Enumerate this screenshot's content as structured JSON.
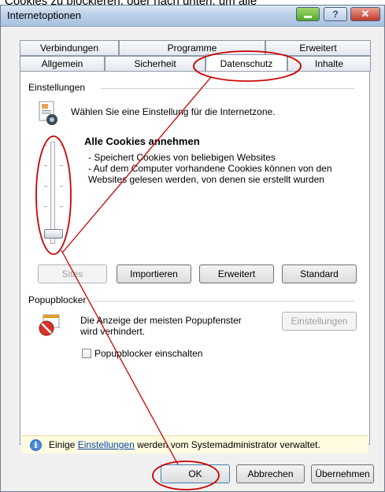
{
  "caption": "Cookies zu blockieren, oder nach unten, um alle",
  "window": {
    "title": "Internetoptionen",
    "help_glyph": "?",
    "close_glyph": "✕"
  },
  "tabs_top": [
    "Verbindungen",
    "Programme",
    "Erweitert"
  ],
  "tabs_bottom": [
    "Allgemein",
    "Sicherheit",
    "Datenschutz",
    "Inhalte"
  ],
  "settings": {
    "group_label": "Einstellungen",
    "zone_text": "Wählen Sie eine Einstellung für die Internetzone.",
    "level_title": "Alle Cookies annehmen",
    "desc_line1": "- Speichert Cookies von beliebigen Websites",
    "desc_line2": "- Auf dem Computer vorhandene Cookies können von den",
    "desc_line3": "Websites gelesen werden, von denen sie erstellt wurden",
    "slider_level": 0
  },
  "privacy_buttons": {
    "sites": "Sites",
    "import": "Importieren",
    "advanced": "Erweitert",
    "default": "Standard"
  },
  "popup": {
    "group_label": "Popupblocker",
    "text_line1": "Die Anzeige der meisten Popupfenster",
    "text_line2": "wird verhindert.",
    "settings_button": "Einstellungen",
    "checkbox_label": "Popupblocker einschalten",
    "checked": false
  },
  "info": {
    "pre": "Einige ",
    "link": "Einstellungen",
    "post": " werden vom Systemadministrator verwaltet."
  },
  "dialog_buttons": {
    "ok": "OK",
    "cancel": "Abbrechen",
    "apply": "Übernehmen"
  },
  "colors": {
    "annotation": "#cc0000",
    "link": "#0645ad"
  }
}
